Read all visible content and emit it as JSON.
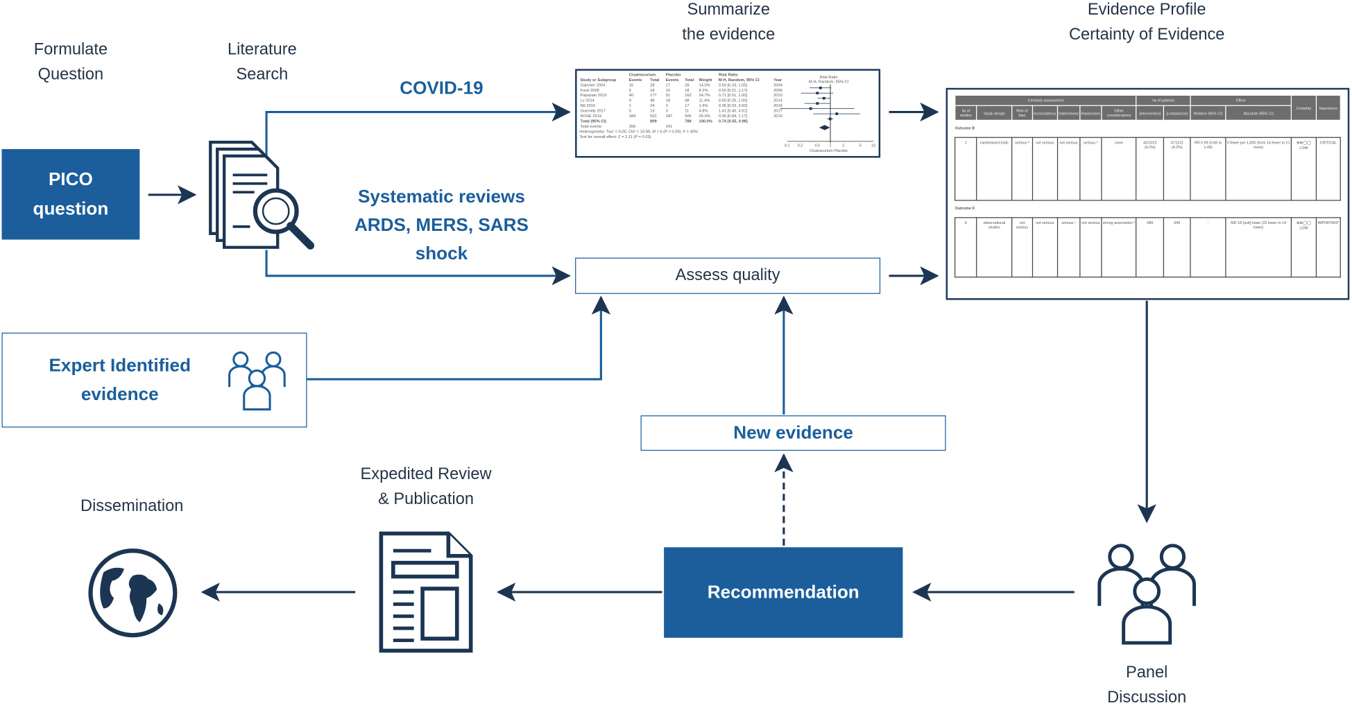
{
  "colors": {
    "primary": "#1b5e9b",
    "dark_arrow": "#1c3553",
    "text": "#243447"
  },
  "labels": {
    "formulate": [
      "Formulate",
      "Question"
    ],
    "literature": [
      "Literature",
      "Search"
    ],
    "summarize": [
      "Summarize",
      "the evidence"
    ],
    "profile": [
      "Evidence Profile",
      "Certainty of Evidence"
    ],
    "panel": [
      "Panel",
      "Discussion"
    ],
    "expedited": [
      "Expedited Review",
      "& Publication"
    ],
    "dissemination": "Dissemination"
  },
  "boxes": {
    "pico": [
      "PICO",
      "question"
    ],
    "covid": "COVID-19",
    "systematic": [
      "Systematic reviews",
      "ARDS, MERS, SARS",
      "shock"
    ],
    "assess": "Assess quality",
    "expert": [
      "Expert Identified",
      "evidence"
    ],
    "new_evidence": "New evidence",
    "recommendation": "Recommendation"
  },
  "icons": [
    "documents-search-icon",
    "users-group-icon",
    "panel-people-icon",
    "document-icon",
    "globe-icon"
  ],
  "forest_plot": {
    "headers": [
      "Study or Subgroup",
      "Events",
      "Total",
      "Events",
      "Total",
      "Weight",
      "M-H, Random, 95% CI",
      "Year"
    ],
    "group_headers": [
      "Cisatracurium",
      "Placebo",
      "Risk Ratio",
      "Risk Ratio"
    ],
    "rows": [
      [
        "Gainnier 2004",
        "16",
        "28",
        "17",
        "28",
        "14.5%",
        "0.59 [0.33, 1.05]",
        "2004"
      ],
      [
        "Forel 2006",
        "5",
        "18",
        "10",
        "18",
        "8.2%",
        "0.50 [0.21, 1.17]",
        "2006"
      ],
      [
        "Papazian 2010",
        "40",
        "177",
        "51",
        "162",
        "24.7%",
        "0.71 [0.51, 1.00]",
        "2010"
      ],
      [
        "Lv 2014",
        "9",
        "48",
        "18",
        "48",
        "11.4%",
        "0.50 [0.25, 1.00]",
        "2014"
      ],
      [
        "Ntt 2016",
        "1",
        "24",
        "2",
        "17",
        "1.4%",
        "0.35 [0.03, 3.60]",
        "2016"
      ],
      [
        "Guervilly 2017",
        "5",
        "15",
        "3",
        "11",
        "4.8%",
        "1.41 [0.40, 4.91]",
        "2017"
      ],
      [
        "ROSE 2019",
        "184",
        "501",
        "187",
        "505",
        "35.0%",
        "0.99 [0.84, 1.17]",
        "2019"
      ]
    ],
    "total_row": [
      "Total (95% CI)",
      "",
      "809",
      "",
      "789",
      "100.0%",
      "0.74 [0.55, 0.98]"
    ],
    "events_row": [
      "Total events",
      "256",
      "",
      "241"
    ],
    "heterogeneity": "Heterogeneity: Tau² = 0.05; Chi² = 10.99, df = 6 (P = 0.09); I² = 45%",
    "overall": "Test for overall effect: Z = 2.11 (P = 0.03)",
    "axis_ticks": [
      "0.1",
      "0.2",
      "0.5",
      "1",
      "2",
      "5",
      "10"
    ],
    "axis_labels": "Cisatracurium  Placebo",
    "plot_title": "Risk Ratio",
    "plot_sub": "M-H, Random, 95% CI"
  },
  "evidence_table": {
    "group_headers": [
      "Certainty assessment",
      "№ of patients",
      "Effect",
      "Certainty",
      "Importance"
    ],
    "headers": [
      "№ of studies",
      "Study design",
      "Risk of bias",
      "Inconsistency",
      "Indirectness",
      "Imprecision",
      "Other considerations",
      "[intervention]",
      "[comparison]",
      "Relative (95% CI)",
      "Absolute (95% CI)"
    ],
    "outcomes": [
      {
        "name": "Outcome B",
        "cells": [
          "1",
          "randomised trials",
          "serious ª",
          "not serious",
          "not serious",
          "serious ᵇ",
          "none",
          "43/1022 (4.2%)",
          "47/1101 (4.2%)",
          "RR 0.99 (0.66 to 1.49)",
          "0 fewer per 1,000 (from 14 fewer to 21 more)",
          "⊕⊕◯◯ LOW",
          "CRITICAL"
        ]
      },
      {
        "name": "Outcome D",
        "cells": [
          "6",
          "observational studies",
          "not serious",
          "not serious",
          "serious ᶜ",
          "not serious",
          "strong association ᵈ",
          "689",
          "645",
          "-",
          "MD 18 [unit] lower (22 lower to 14 lower)",
          "⊕⊕◯◯ LOW",
          "IMPORTANT"
        ]
      }
    ]
  }
}
